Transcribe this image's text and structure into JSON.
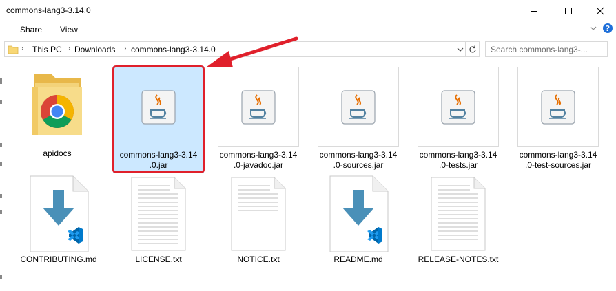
{
  "window": {
    "title": "commons-lang3-3.14.0"
  },
  "ribbon": {
    "tabs": [
      "Share",
      "View"
    ]
  },
  "address": {
    "crumbs": [
      "This PC",
      "Downloads",
      "commons-lang3-3.14.0"
    ],
    "search_placeholder": "Search commons-lang3-..."
  },
  "files": [
    {
      "line1": "apidocs",
      "line2": "",
      "icon": "chrome-folder-icon"
    },
    {
      "line1": "commons-lang3-3.14",
      "line2": ".0.jar",
      "icon": "java-jar-icon",
      "selected": true
    },
    {
      "line1": "commons-lang3-3.14",
      "line2": ".0-javadoc.jar",
      "icon": "java-jar-icon"
    },
    {
      "line1": "commons-lang3-3.14",
      "line2": ".0-sources.jar",
      "icon": "java-jar-icon"
    },
    {
      "line1": "commons-lang3-3.14",
      "line2": ".0-tests.jar",
      "icon": "java-jar-icon"
    },
    {
      "line1": "commons-lang3-3.14",
      "line2": ".0-test-sources.jar",
      "icon": "java-jar-icon"
    },
    {
      "line1": "CONTRIBUTING.md",
      "line2": "",
      "icon": "vscode-md-icon"
    },
    {
      "line1": "LICENSE.txt",
      "line2": "",
      "icon": "text-file-icon"
    },
    {
      "line1": "NOTICE.txt",
      "line2": "",
      "icon": "text-file-icon"
    },
    {
      "line1": "README.md",
      "line2": "",
      "icon": "vscode-md-icon"
    },
    {
      "line1": "RELEASE-NOTES.txt",
      "line2": "",
      "icon": "text-file-icon"
    }
  ],
  "colors": {
    "selection": "#cce8ff",
    "annotation": "#e0202b",
    "vscode_blue": "#0065a9",
    "download_arrow": "#4a90b8"
  }
}
